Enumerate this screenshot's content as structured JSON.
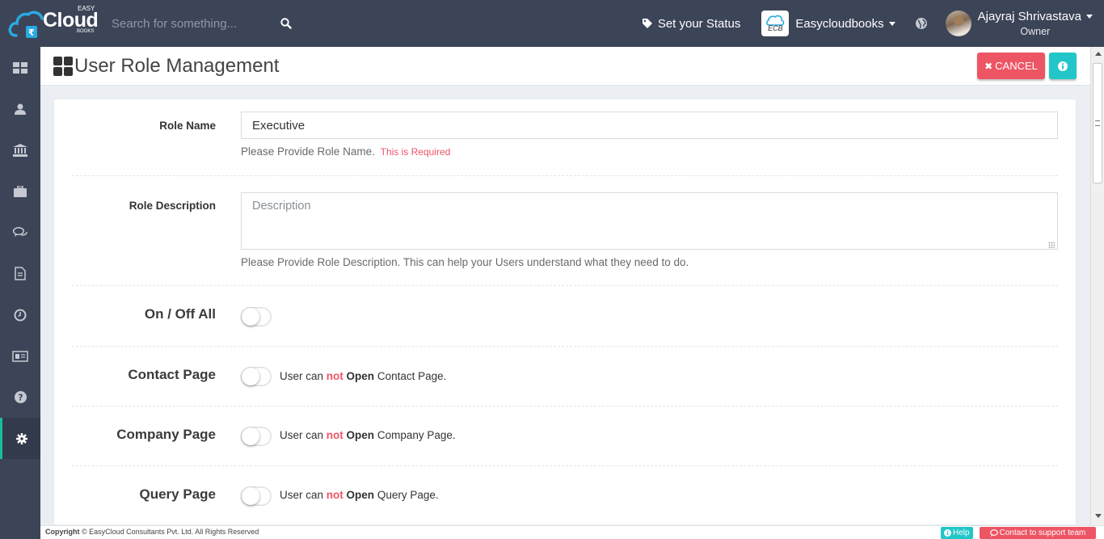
{
  "app": {
    "brand": "Cloud",
    "brand_top": "EASY",
    "brand_sub": "BOOKS",
    "accent_color": "#1abc9c",
    "topbar_color": "#3c4457"
  },
  "header": {
    "search_placeholder": "Search for something...",
    "status_label": "Set your Status",
    "company_logo_text": "ECB",
    "company_name": "Easycloudbooks",
    "user_name": "Ajayraj Shrivastava",
    "user_role": "Owner"
  },
  "sidebar": {
    "items": [
      {
        "icon": "dashboard-icon"
      },
      {
        "icon": "user-icon"
      },
      {
        "icon": "bank-icon"
      },
      {
        "icon": "briefcase-icon"
      },
      {
        "icon": "chat-icon"
      },
      {
        "icon": "document-icon"
      },
      {
        "icon": "clock-icon"
      },
      {
        "icon": "news-icon"
      },
      {
        "icon": "question-icon"
      },
      {
        "icon": "gear-icon",
        "active": true
      }
    ]
  },
  "page": {
    "title": "User Role Management",
    "cancel_label": "CANCEL",
    "cancel_color": "#ed5565",
    "info_color": "#23c6c8"
  },
  "form": {
    "role_name_label": "Role Name",
    "role_name_value": "Executive",
    "role_name_help": "Please Provide Role Name.",
    "role_name_required": "This is Required",
    "role_desc_label": "Role Description",
    "role_desc_placeholder": "Description",
    "role_desc_help": "Please Provide Role Description. This can help your Users understand what they need to do.",
    "toggle_all_label": "On / Off All",
    "permissions": [
      {
        "label": "Contact Page",
        "prefix": "User can ",
        "not": "not",
        "open": "Open",
        "suffix": "Contact Page.",
        "enabled": false
      },
      {
        "label": "Company Page",
        "prefix": "User can ",
        "not": "not",
        "open": "Open",
        "suffix": "Company Page.",
        "enabled": false
      },
      {
        "label": "Query Page",
        "prefix": "User can ",
        "not": "not",
        "open": "Open",
        "suffix": "Query Page.",
        "enabled": false
      }
    ]
  },
  "footer": {
    "copyright_bold": "Copyright",
    "copyright_text": "© EasyCloud Consultants Pvt. Ltd. All Rights Reserved",
    "help_label": "Help",
    "support_label": "Contact to support team"
  }
}
